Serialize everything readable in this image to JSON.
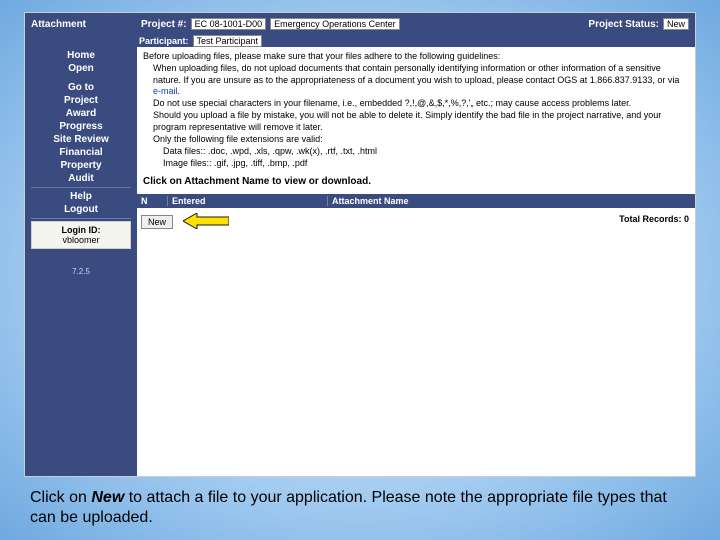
{
  "header": {
    "title": "Attachment",
    "project_number_label": "Project #:",
    "project_number": "EC 08-1001-D00",
    "project_name": "Emergency Operations Center",
    "status_label": "Project Status:",
    "status_value": "New",
    "participant_label": "Participant:",
    "participant_value": "Test Participant"
  },
  "sidebar": {
    "items": [
      {
        "label": "Home"
      },
      {
        "label": "Open"
      },
      {
        "label": "Go to"
      },
      {
        "label": "Project"
      },
      {
        "label": "Award"
      },
      {
        "label": "Progress"
      },
      {
        "label": "Site Review"
      },
      {
        "label": "Financial"
      },
      {
        "label": "Property"
      },
      {
        "label": "Audit"
      },
      {
        "label": "Help"
      },
      {
        "label": "Logout"
      }
    ],
    "login_label": "Login ID:",
    "login_value": "vbloomer",
    "version": "7.2.5"
  },
  "guidelines": {
    "l0": "Before uploading files, please make sure that your files adhere to the following guidelines:",
    "l1": "When uploading files, do not upload documents that contain personally identifying information or other information of a sensitive nature. If you are unsure as to the appropriateness of a document you wish to upload, please contact OGS at 1.866.837.9133, or via ",
    "l1_link": "e-mail",
    "l1_end": ".",
    "l2": "Do not use special characters in your filename, i.e., embedded ?,!,@,&,$,*,%,?,'„ etc.; may cause access problems later.",
    "l3": "Should you upload a file by mistake, you will not be able to delete it. Simply identify the bad file in the project narrative, and your program representative will remove it later.",
    "l4": "Only the following file extensions are valid:",
    "l5": "Data files:: .doc, .wpd, .xls, .qpw, .wk(x), .rtf, .txt, .html",
    "l6": "Image files:: .gif, .jpg, .tiff, .bmp, .pdf",
    "callout": "Click on Attachment Name to view or download."
  },
  "table": {
    "col1": "N",
    "col2": "Entered",
    "col3": "Attachment Name",
    "new_label": "New",
    "total_label": "Total Records:",
    "total_value": "0"
  },
  "caption": {
    "pre": "Click on ",
    "em": "New",
    "post": " to attach a file to your application.  Please note the appropriate file types that can be uploaded."
  }
}
